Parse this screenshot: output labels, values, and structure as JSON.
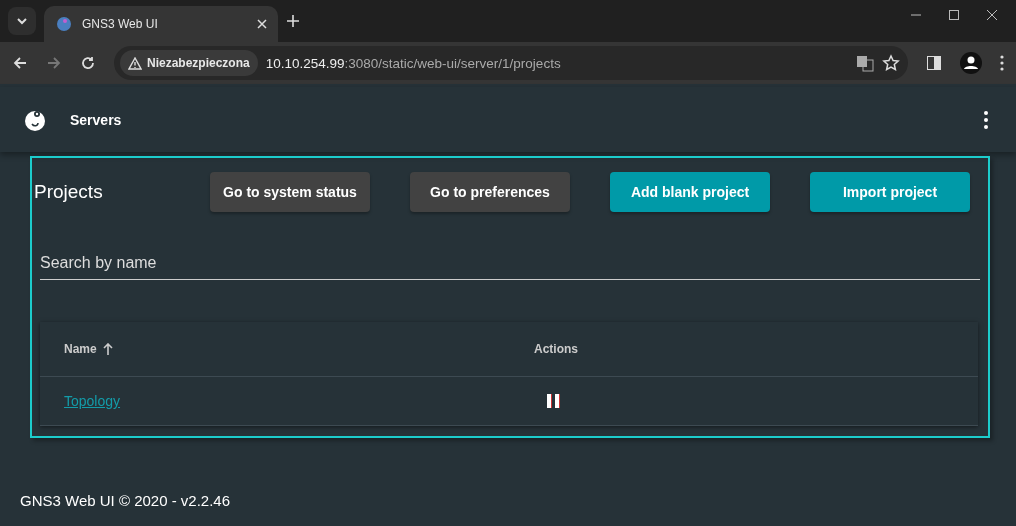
{
  "browser": {
    "tab": {
      "title": "GNS3 Web UI",
      "selected": true
    },
    "address": {
      "security": "Niezabezpieczona",
      "host": "10.10.254.99",
      "path": ":3080/static/web-ui/server/1/projects"
    }
  },
  "header": {
    "title": "Servers"
  },
  "projects": {
    "title": "Projects",
    "buttons": [
      {
        "label": "Go to system status",
        "kind": "secondary"
      },
      {
        "label": "Go to preferences",
        "kind": "secondary"
      },
      {
        "label": "Add blank project",
        "kind": "primary"
      },
      {
        "label": "Import project",
        "kind": "primary"
      }
    ],
    "search": {
      "placeholder": "Search by name"
    },
    "table": {
      "columns": [
        {
          "label": "Name",
          "sorted": true
        },
        {
          "label": "Actions",
          "sorted": false
        }
      ],
      "rows": [
        {
          "name": "Topology"
        }
      ]
    }
  },
  "footer": "GNS3 Web UI © 2020 - v2.2.46"
}
